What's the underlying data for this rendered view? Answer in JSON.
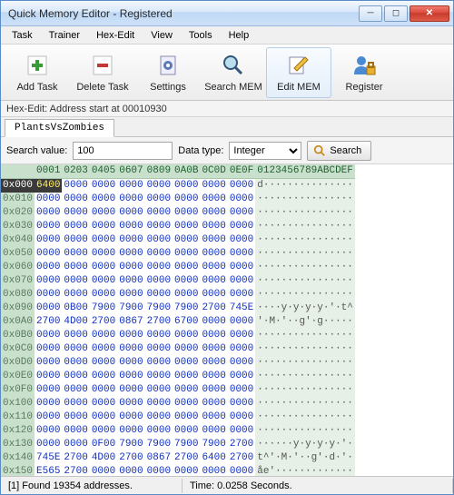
{
  "window": {
    "title": "Quick Memory Editor - Registered"
  },
  "menu": [
    "Task",
    "Trainer",
    "Hex-Edit",
    "View",
    "Tools",
    "Help"
  ],
  "toolbar": [
    {
      "label": "Add Task",
      "icon": "plus"
    },
    {
      "label": "Delete Task",
      "icon": "minus"
    },
    {
      "label": "Settings",
      "icon": "gear"
    },
    {
      "label": "Search MEM",
      "icon": "magnifier"
    },
    {
      "label": "Edit MEM",
      "icon": "edit",
      "active": true
    },
    {
      "label": "Register",
      "icon": "person-lock"
    }
  ],
  "addrbar": "Hex-Edit: Address start at 00010930",
  "tab": "PlantsVsZombies",
  "search": {
    "label": "Search value:",
    "value": "100",
    "dtlabel": "Data type:",
    "dtvalue": "Integer",
    "button": "Search"
  },
  "hex": {
    "header_cols": [
      "0001",
      "0203",
      "0405",
      "0607",
      "0809",
      "0A0B",
      "0C0D",
      "0E0F"
    ],
    "ascii_header": "0123456789ABCDEF",
    "rows": [
      {
        "addr": "0x000",
        "sel": true,
        "selw": [
          0
        ],
        "w": [
          "6400",
          "0000",
          "0000",
          "0000",
          "0000",
          "0000",
          "0000",
          "0000"
        ],
        "a": "d···············"
      },
      {
        "addr": "0x010",
        "w": [
          "0000",
          "0000",
          "0000",
          "0000",
          "0000",
          "0000",
          "0000",
          "0000"
        ],
        "a": "················"
      },
      {
        "addr": "0x020",
        "w": [
          "0000",
          "0000",
          "0000",
          "0000",
          "0000",
          "0000",
          "0000",
          "0000"
        ],
        "a": "················"
      },
      {
        "addr": "0x030",
        "w": [
          "0000",
          "0000",
          "0000",
          "0000",
          "0000",
          "0000",
          "0000",
          "0000"
        ],
        "a": "················"
      },
      {
        "addr": "0x040",
        "w": [
          "0000",
          "0000",
          "0000",
          "0000",
          "0000",
          "0000",
          "0000",
          "0000"
        ],
        "a": "················"
      },
      {
        "addr": "0x050",
        "w": [
          "0000",
          "0000",
          "0000",
          "0000",
          "0000",
          "0000",
          "0000",
          "0000"
        ],
        "a": "················"
      },
      {
        "addr": "0x060",
        "w": [
          "0000",
          "0000",
          "0000",
          "0000",
          "0000",
          "0000",
          "0000",
          "0000"
        ],
        "a": "················"
      },
      {
        "addr": "0x070",
        "w": [
          "0000",
          "0000",
          "0000",
          "0000",
          "0000",
          "0000",
          "0000",
          "0000"
        ],
        "a": "················"
      },
      {
        "addr": "0x080",
        "w": [
          "0000",
          "0000",
          "0000",
          "0000",
          "0000",
          "0000",
          "0000",
          "0000"
        ],
        "a": "················"
      },
      {
        "addr": "0x090",
        "w": [
          "0000",
          "0B00",
          "7900",
          "7900",
          "7900",
          "7900",
          "2700",
          "745E"
        ],
        "a": "····y·y·y·y·'·t^"
      },
      {
        "addr": "0x0A0",
        "w": [
          "2700",
          "4D00",
          "2700",
          "0867",
          "2700",
          "6700",
          "0000",
          "0000"
        ],
        "a": "'·M·'··g'·g·····"
      },
      {
        "addr": "0x0B0",
        "w": [
          "0000",
          "0000",
          "0000",
          "0000",
          "0000",
          "0000",
          "0000",
          "0000"
        ],
        "a": "················"
      },
      {
        "addr": "0x0C0",
        "w": [
          "0000",
          "0000",
          "0000",
          "0000",
          "0000",
          "0000",
          "0000",
          "0000"
        ],
        "a": "················"
      },
      {
        "addr": "0x0D0",
        "w": [
          "0000",
          "0000",
          "0000",
          "0000",
          "0000",
          "0000",
          "0000",
          "0000"
        ],
        "a": "················"
      },
      {
        "addr": "0x0E0",
        "w": [
          "0000",
          "0000",
          "0000",
          "0000",
          "0000",
          "0000",
          "0000",
          "0000"
        ],
        "a": "················"
      },
      {
        "addr": "0x0F0",
        "w": [
          "0000",
          "0000",
          "0000",
          "0000",
          "0000",
          "0000",
          "0000",
          "0000"
        ],
        "a": "················"
      },
      {
        "addr": "0x100",
        "w": [
          "0000",
          "0000",
          "0000",
          "0000",
          "0000",
          "0000",
          "0000",
          "0000"
        ],
        "a": "················"
      },
      {
        "addr": "0x110",
        "w": [
          "0000",
          "0000",
          "0000",
          "0000",
          "0000",
          "0000",
          "0000",
          "0000"
        ],
        "a": "················"
      },
      {
        "addr": "0x120",
        "w": [
          "0000",
          "0000",
          "0000",
          "0000",
          "0000",
          "0000",
          "0000",
          "0000"
        ],
        "a": "················"
      },
      {
        "addr": "0x130",
        "w": [
          "0000",
          "0000",
          "0F00",
          "7900",
          "7900",
          "7900",
          "7900",
          "2700"
        ],
        "a": "······y·y·y·y·'·"
      },
      {
        "addr": "0x140",
        "w": [
          "745E",
          "2700",
          "4D00",
          "2700",
          "0867",
          "2700",
          "6400",
          "2700"
        ],
        "a": "t^'·M·'··g'·d·'·"
      },
      {
        "addr": "0x150",
        "w": [
          "E565",
          "2700",
          "0000",
          "0000",
          "0000",
          "0000",
          "0000",
          "0000"
        ],
        "a": "åe'·············"
      }
    ]
  },
  "status": {
    "found": "[1] Found 19354 addresses.",
    "time": "Time:   0.0258 Seconds."
  },
  "colors": {
    "hex_value": "#1030c0",
    "header_bg": "#c8e0cc",
    "sel_bg": "#3a3a3a",
    "sel_fg": "#ffee66"
  }
}
